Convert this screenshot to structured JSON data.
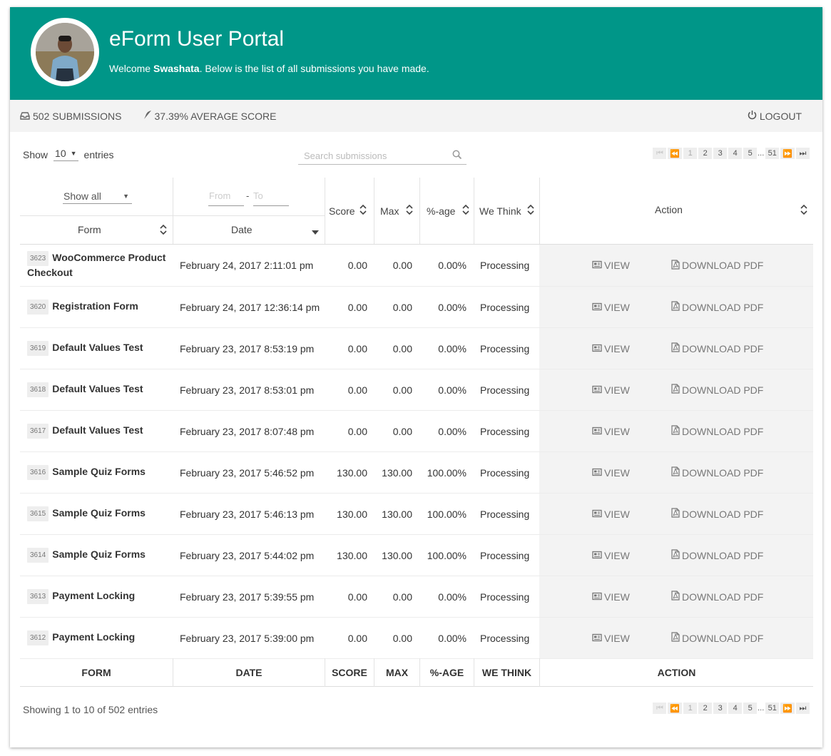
{
  "header": {
    "title": "eForm User Portal",
    "welcome_prefix": "Welcome ",
    "user_name": "Swashata",
    "welcome_suffix": ". Below is the list of all submissions you have made."
  },
  "stats": {
    "submissions": "502 SUBMISSIONS",
    "average": "37.39% AVERAGE SCORE",
    "logout": "LOGOUT"
  },
  "controls": {
    "show_label": "Show",
    "show_value": "10",
    "entries_label": "entries",
    "search_placeholder": "Search submissions"
  },
  "pagination": {
    "pages": [
      "1",
      "2",
      "3",
      "4",
      "5"
    ],
    "ellipsis": "...",
    "last": "51"
  },
  "columns": {
    "form_filter": "Show all",
    "from_placeholder": "From",
    "dash": "-",
    "to_placeholder": "To",
    "form": "Form",
    "date": "Date",
    "score": "Score",
    "max": "Max",
    "percent": "%-age",
    "we_think": "We Think",
    "action": "Action"
  },
  "footer_columns": {
    "form": "FORM",
    "date": "DATE",
    "score": "SCORE",
    "max": "MAX",
    "percent": "%-AGE",
    "we_think": "WE THINK",
    "action": "ACTION"
  },
  "actions": {
    "view": "VIEW",
    "download": "DOWNLOAD PDF"
  },
  "rows": [
    {
      "id": "3623",
      "form": "WooCommerce Product Checkout",
      "date": "February 24, 2017 2:11:01 pm",
      "score": "0.00",
      "max": "0.00",
      "percent": "0.00%",
      "status": "Processing"
    },
    {
      "id": "3620",
      "form": "Registration Form",
      "date": "February 24, 2017 12:36:14 pm",
      "score": "0.00",
      "max": "0.00",
      "percent": "0.00%",
      "status": "Processing"
    },
    {
      "id": "3619",
      "form": "Default Values Test",
      "date": "February 23, 2017 8:53:19 pm",
      "score": "0.00",
      "max": "0.00",
      "percent": "0.00%",
      "status": "Processing"
    },
    {
      "id": "3618",
      "form": "Default Values Test",
      "date": "February 23, 2017 8:53:01 pm",
      "score": "0.00",
      "max": "0.00",
      "percent": "0.00%",
      "status": "Processing"
    },
    {
      "id": "3617",
      "form": "Default Values Test",
      "date": "February 23, 2017 8:07:48 pm",
      "score": "0.00",
      "max": "0.00",
      "percent": "0.00%",
      "status": "Processing"
    },
    {
      "id": "3616",
      "form": "Sample Quiz Forms",
      "date": "February 23, 2017 5:46:52 pm",
      "score": "130.00",
      "max": "130.00",
      "percent": "100.00%",
      "status": "Processing"
    },
    {
      "id": "3615",
      "form": "Sample Quiz Forms",
      "date": "February 23, 2017 5:46:13 pm",
      "score": "130.00",
      "max": "130.00",
      "percent": "100.00%",
      "status": "Processing"
    },
    {
      "id": "3614",
      "form": "Sample Quiz Forms",
      "date": "February 23, 2017 5:44:02 pm",
      "score": "130.00",
      "max": "130.00",
      "percent": "100.00%",
      "status": "Processing"
    },
    {
      "id": "3613",
      "form": "Payment Locking",
      "date": "February 23, 2017 5:39:55 pm",
      "score": "0.00",
      "max": "0.00",
      "percent": "0.00%",
      "status": "Processing"
    },
    {
      "id": "3612",
      "form": "Payment Locking",
      "date": "February 23, 2017 5:39:00 pm",
      "score": "0.00",
      "max": "0.00",
      "percent": "0.00%",
      "status": "Processing"
    }
  ],
  "summary": "Showing 1 to 10 of 502 entries",
  "colors": {
    "header_bg": "#009688",
    "stats_bg": "#f3f3f3",
    "action_bg": "#f3f3f3"
  }
}
